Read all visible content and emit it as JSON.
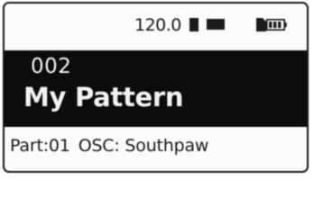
{
  "status": {
    "tempo": "120.0",
    "icons": [
      "tempo-marker",
      "status-block-icon",
      "sd-card-icon",
      "battery-icon"
    ]
  },
  "pattern": {
    "number": "002",
    "name": "My Pattern"
  },
  "info": {
    "part": "Part:01",
    "osc": "OSC: Southpaw"
  },
  "colors": {
    "lcd_background": "#fbfbfb",
    "ink": "#1a1a1a",
    "band": "#0c0c0c",
    "band_text": "#f2f2f2"
  }
}
